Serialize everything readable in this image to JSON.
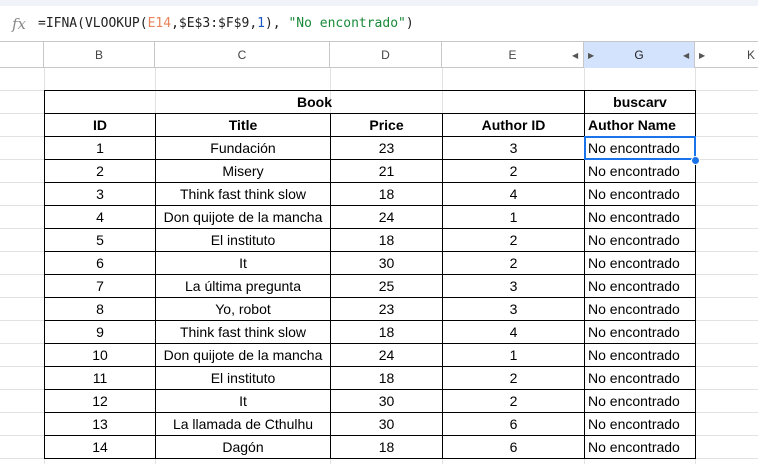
{
  "formula_bar": {
    "icon": "fx-icon",
    "fx": "fx",
    "parts": {
      "p1": "=IFNA(VLOOKUP(",
      "ref": "E14",
      "p2": ",$E$3:$F$9,",
      "n": "1",
      "p3": "), ",
      "str": "\"No encontrado\"",
      "p4": ")"
    }
  },
  "columns": [
    "B",
    "C",
    "D",
    "E",
    "G",
    "K"
  ],
  "table": {
    "group1": "Book",
    "group2": "buscarv",
    "headers": [
      "ID",
      "Title",
      "Price",
      "Author ID",
      "Author Name"
    ],
    "rows": [
      [
        "1",
        "Fundación",
        "23",
        "3",
        "No encontrado"
      ],
      [
        "2",
        "Misery",
        "21",
        "2",
        "No encontrado"
      ],
      [
        "3",
        "Think fast think slow",
        "18",
        "4",
        "No encontrado"
      ],
      [
        "4",
        "Don quijote de la mancha",
        "24",
        "1",
        "No encontrado"
      ],
      [
        "5",
        "El instituto",
        "18",
        "2",
        "No encontrado"
      ],
      [
        "6",
        "It",
        "30",
        "2",
        "No encontrado"
      ],
      [
        "7",
        "La última pregunta",
        "25",
        "3",
        "No encontrado"
      ],
      [
        "8",
        "Yo, robot",
        "23",
        "3",
        "No encontrado"
      ],
      [
        "9",
        "Think fast think slow",
        "18",
        "4",
        "No encontrado"
      ],
      [
        "10",
        "Don quijote de la mancha",
        "24",
        "1",
        "No encontrado"
      ],
      [
        "11",
        "El instituto",
        "18",
        "2",
        "No encontrado"
      ],
      [
        "12",
        "It",
        "30",
        "2",
        "No encontrado"
      ],
      [
        "13",
        "La llamada de Cthulhu",
        "30",
        "6",
        "No encontrado"
      ],
      [
        "14",
        "Dagón",
        "18",
        "6",
        "No encontrado"
      ]
    ]
  },
  "colors": {
    "selection": "#1a73e8",
    "selected_header": "#d3e3fd"
  }
}
